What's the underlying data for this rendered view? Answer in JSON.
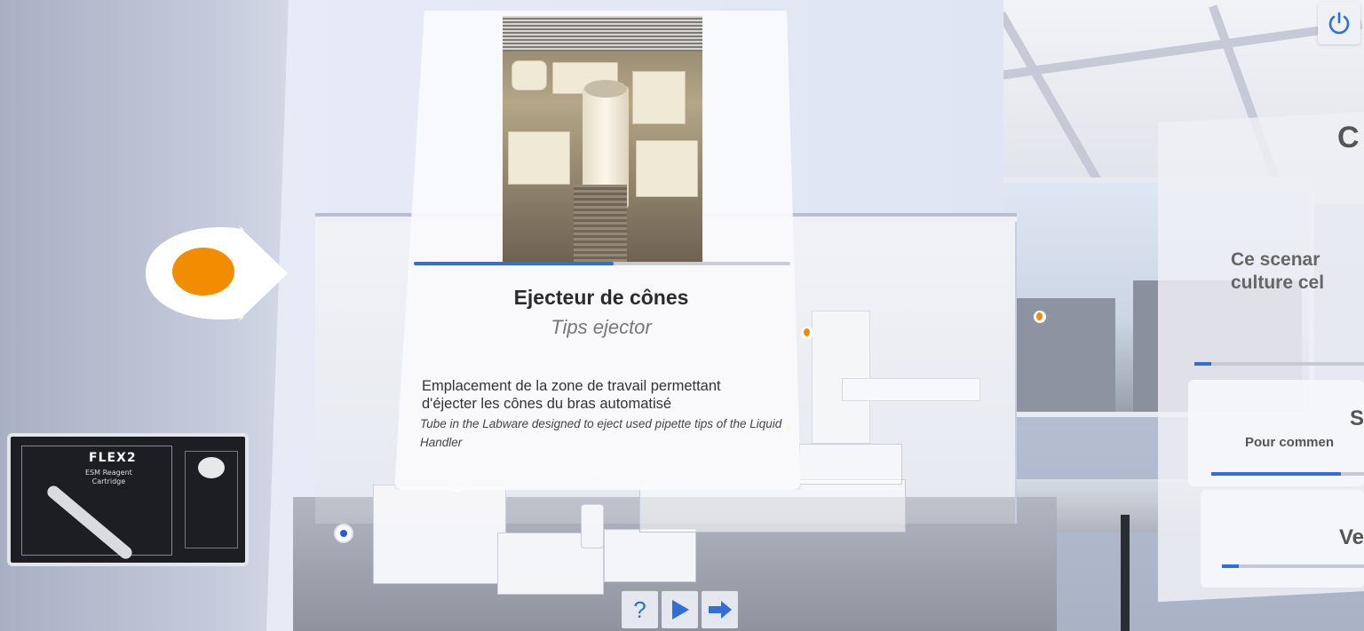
{
  "card": {
    "title": "Ejecteur de cônes",
    "subtitle": "Tips ejector",
    "description_fr": "Emplacement de la zone de travail permettant d'éjecter les cônes du bras automatisé",
    "description_en": "Tube in the Labware designed to eject used pipette tips of the Liquid Handler",
    "progress": 0.53
  },
  "scenario_panel": {
    "title": "C",
    "text_line1": "Ce scenar",
    "text_line2": "culture cel",
    "progress": 0.1,
    "cards": [
      {
        "title": "S",
        "text": "Pour commen",
        "progress": 0.85
      },
      {
        "title": "Ve",
        "text": "",
        "progress": 0.12
      }
    ]
  },
  "device": {
    "brand": "FLEX2",
    "label_line1": "ESM Reagent",
    "label_line2": "Cartridge"
  },
  "controls": {
    "help_label": "?",
    "play_icon": "play-icon",
    "next_icon": "arrow-right-icon",
    "power_icon": "power-icon"
  },
  "colors": {
    "accent": "#2f6fd6",
    "marker_orange": "#f28c00",
    "hotspot_blue": "#1e5fd8"
  }
}
